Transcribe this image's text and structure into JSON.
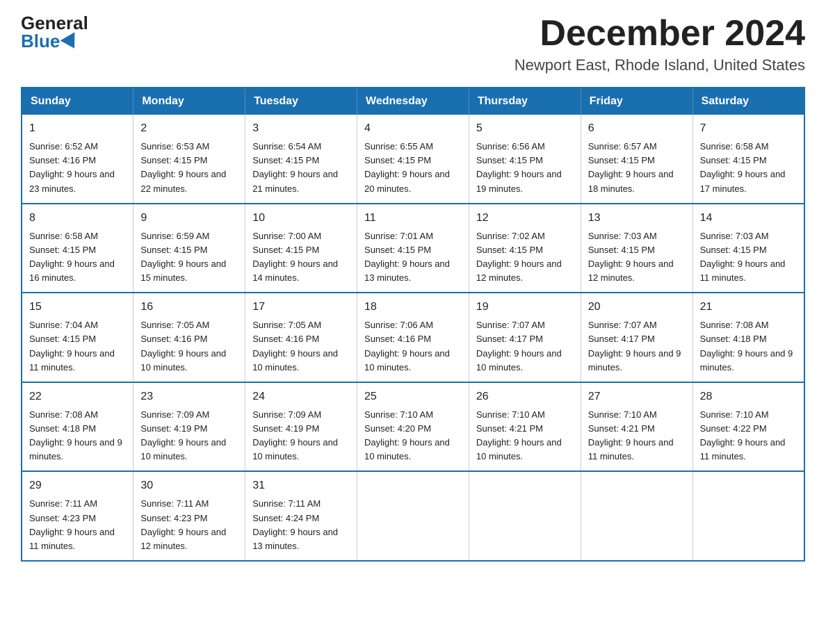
{
  "logo": {
    "general": "General",
    "blue": "Blue"
  },
  "header": {
    "month": "December 2024",
    "location": "Newport East, Rhode Island, United States"
  },
  "days_of_week": [
    "Sunday",
    "Monday",
    "Tuesday",
    "Wednesday",
    "Thursday",
    "Friday",
    "Saturday"
  ],
  "weeks": [
    [
      {
        "day": "1",
        "sunrise": "6:52 AM",
        "sunset": "4:16 PM",
        "daylight": "9 hours and 23 minutes."
      },
      {
        "day": "2",
        "sunrise": "6:53 AM",
        "sunset": "4:15 PM",
        "daylight": "9 hours and 22 minutes."
      },
      {
        "day": "3",
        "sunrise": "6:54 AM",
        "sunset": "4:15 PM",
        "daylight": "9 hours and 21 minutes."
      },
      {
        "day": "4",
        "sunrise": "6:55 AM",
        "sunset": "4:15 PM",
        "daylight": "9 hours and 20 minutes."
      },
      {
        "day": "5",
        "sunrise": "6:56 AM",
        "sunset": "4:15 PM",
        "daylight": "9 hours and 19 minutes."
      },
      {
        "day": "6",
        "sunrise": "6:57 AM",
        "sunset": "4:15 PM",
        "daylight": "9 hours and 18 minutes."
      },
      {
        "day": "7",
        "sunrise": "6:58 AM",
        "sunset": "4:15 PM",
        "daylight": "9 hours and 17 minutes."
      }
    ],
    [
      {
        "day": "8",
        "sunrise": "6:58 AM",
        "sunset": "4:15 PM",
        "daylight": "9 hours and 16 minutes."
      },
      {
        "day": "9",
        "sunrise": "6:59 AM",
        "sunset": "4:15 PM",
        "daylight": "9 hours and 15 minutes."
      },
      {
        "day": "10",
        "sunrise": "7:00 AM",
        "sunset": "4:15 PM",
        "daylight": "9 hours and 14 minutes."
      },
      {
        "day": "11",
        "sunrise": "7:01 AM",
        "sunset": "4:15 PM",
        "daylight": "9 hours and 13 minutes."
      },
      {
        "day": "12",
        "sunrise": "7:02 AM",
        "sunset": "4:15 PM",
        "daylight": "9 hours and 12 minutes."
      },
      {
        "day": "13",
        "sunrise": "7:03 AM",
        "sunset": "4:15 PM",
        "daylight": "9 hours and 12 minutes."
      },
      {
        "day": "14",
        "sunrise": "7:03 AM",
        "sunset": "4:15 PM",
        "daylight": "9 hours and 11 minutes."
      }
    ],
    [
      {
        "day": "15",
        "sunrise": "7:04 AM",
        "sunset": "4:15 PM",
        "daylight": "9 hours and 11 minutes."
      },
      {
        "day": "16",
        "sunrise": "7:05 AM",
        "sunset": "4:16 PM",
        "daylight": "9 hours and 10 minutes."
      },
      {
        "day": "17",
        "sunrise": "7:05 AM",
        "sunset": "4:16 PM",
        "daylight": "9 hours and 10 minutes."
      },
      {
        "day": "18",
        "sunrise": "7:06 AM",
        "sunset": "4:16 PM",
        "daylight": "9 hours and 10 minutes."
      },
      {
        "day": "19",
        "sunrise": "7:07 AM",
        "sunset": "4:17 PM",
        "daylight": "9 hours and 10 minutes."
      },
      {
        "day": "20",
        "sunrise": "7:07 AM",
        "sunset": "4:17 PM",
        "daylight": "9 hours and 9 minutes."
      },
      {
        "day": "21",
        "sunrise": "7:08 AM",
        "sunset": "4:18 PM",
        "daylight": "9 hours and 9 minutes."
      }
    ],
    [
      {
        "day": "22",
        "sunrise": "7:08 AM",
        "sunset": "4:18 PM",
        "daylight": "9 hours and 9 minutes."
      },
      {
        "day": "23",
        "sunrise": "7:09 AM",
        "sunset": "4:19 PM",
        "daylight": "9 hours and 10 minutes."
      },
      {
        "day": "24",
        "sunrise": "7:09 AM",
        "sunset": "4:19 PM",
        "daylight": "9 hours and 10 minutes."
      },
      {
        "day": "25",
        "sunrise": "7:10 AM",
        "sunset": "4:20 PM",
        "daylight": "9 hours and 10 minutes."
      },
      {
        "day": "26",
        "sunrise": "7:10 AM",
        "sunset": "4:21 PM",
        "daylight": "9 hours and 10 minutes."
      },
      {
        "day": "27",
        "sunrise": "7:10 AM",
        "sunset": "4:21 PM",
        "daylight": "9 hours and 11 minutes."
      },
      {
        "day": "28",
        "sunrise": "7:10 AM",
        "sunset": "4:22 PM",
        "daylight": "9 hours and 11 minutes."
      }
    ],
    [
      {
        "day": "29",
        "sunrise": "7:11 AM",
        "sunset": "4:23 PM",
        "daylight": "9 hours and 11 minutes."
      },
      {
        "day": "30",
        "sunrise": "7:11 AM",
        "sunset": "4:23 PM",
        "daylight": "9 hours and 12 minutes."
      },
      {
        "day": "31",
        "sunrise": "7:11 AM",
        "sunset": "4:24 PM",
        "daylight": "9 hours and 13 minutes."
      },
      null,
      null,
      null,
      null
    ]
  ]
}
